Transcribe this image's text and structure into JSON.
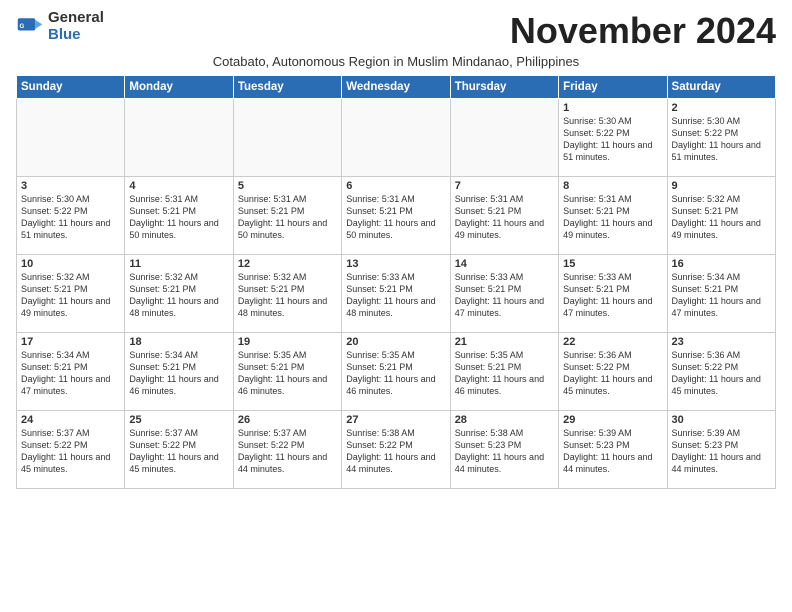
{
  "logo": {
    "general": "General",
    "blue": "Blue"
  },
  "title": "November 2024",
  "subtitle": "Cotabato, Autonomous Region in Muslim Mindanao, Philippines",
  "days_of_week": [
    "Sunday",
    "Monday",
    "Tuesday",
    "Wednesday",
    "Thursday",
    "Friday",
    "Saturday"
  ],
  "weeks": [
    [
      {
        "day": "",
        "info": ""
      },
      {
        "day": "",
        "info": ""
      },
      {
        "day": "",
        "info": ""
      },
      {
        "day": "",
        "info": ""
      },
      {
        "day": "",
        "info": ""
      },
      {
        "day": "1",
        "info": "Sunrise: 5:30 AM\nSunset: 5:22 PM\nDaylight: 11 hours and 51 minutes."
      },
      {
        "day": "2",
        "info": "Sunrise: 5:30 AM\nSunset: 5:22 PM\nDaylight: 11 hours and 51 minutes."
      }
    ],
    [
      {
        "day": "3",
        "info": "Sunrise: 5:30 AM\nSunset: 5:22 PM\nDaylight: 11 hours and 51 minutes."
      },
      {
        "day": "4",
        "info": "Sunrise: 5:31 AM\nSunset: 5:21 PM\nDaylight: 11 hours and 50 minutes."
      },
      {
        "day": "5",
        "info": "Sunrise: 5:31 AM\nSunset: 5:21 PM\nDaylight: 11 hours and 50 minutes."
      },
      {
        "day": "6",
        "info": "Sunrise: 5:31 AM\nSunset: 5:21 PM\nDaylight: 11 hours and 50 minutes."
      },
      {
        "day": "7",
        "info": "Sunrise: 5:31 AM\nSunset: 5:21 PM\nDaylight: 11 hours and 49 minutes."
      },
      {
        "day": "8",
        "info": "Sunrise: 5:31 AM\nSunset: 5:21 PM\nDaylight: 11 hours and 49 minutes."
      },
      {
        "day": "9",
        "info": "Sunrise: 5:32 AM\nSunset: 5:21 PM\nDaylight: 11 hours and 49 minutes."
      }
    ],
    [
      {
        "day": "10",
        "info": "Sunrise: 5:32 AM\nSunset: 5:21 PM\nDaylight: 11 hours and 49 minutes."
      },
      {
        "day": "11",
        "info": "Sunrise: 5:32 AM\nSunset: 5:21 PM\nDaylight: 11 hours and 48 minutes."
      },
      {
        "day": "12",
        "info": "Sunrise: 5:32 AM\nSunset: 5:21 PM\nDaylight: 11 hours and 48 minutes."
      },
      {
        "day": "13",
        "info": "Sunrise: 5:33 AM\nSunset: 5:21 PM\nDaylight: 11 hours and 48 minutes."
      },
      {
        "day": "14",
        "info": "Sunrise: 5:33 AM\nSunset: 5:21 PM\nDaylight: 11 hours and 47 minutes."
      },
      {
        "day": "15",
        "info": "Sunrise: 5:33 AM\nSunset: 5:21 PM\nDaylight: 11 hours and 47 minutes."
      },
      {
        "day": "16",
        "info": "Sunrise: 5:34 AM\nSunset: 5:21 PM\nDaylight: 11 hours and 47 minutes."
      }
    ],
    [
      {
        "day": "17",
        "info": "Sunrise: 5:34 AM\nSunset: 5:21 PM\nDaylight: 11 hours and 47 minutes."
      },
      {
        "day": "18",
        "info": "Sunrise: 5:34 AM\nSunset: 5:21 PM\nDaylight: 11 hours and 46 minutes."
      },
      {
        "day": "19",
        "info": "Sunrise: 5:35 AM\nSunset: 5:21 PM\nDaylight: 11 hours and 46 minutes."
      },
      {
        "day": "20",
        "info": "Sunrise: 5:35 AM\nSunset: 5:21 PM\nDaylight: 11 hours and 46 minutes."
      },
      {
        "day": "21",
        "info": "Sunrise: 5:35 AM\nSunset: 5:21 PM\nDaylight: 11 hours and 46 minutes."
      },
      {
        "day": "22",
        "info": "Sunrise: 5:36 AM\nSunset: 5:22 PM\nDaylight: 11 hours and 45 minutes."
      },
      {
        "day": "23",
        "info": "Sunrise: 5:36 AM\nSunset: 5:22 PM\nDaylight: 11 hours and 45 minutes."
      }
    ],
    [
      {
        "day": "24",
        "info": "Sunrise: 5:37 AM\nSunset: 5:22 PM\nDaylight: 11 hours and 45 minutes."
      },
      {
        "day": "25",
        "info": "Sunrise: 5:37 AM\nSunset: 5:22 PM\nDaylight: 11 hours and 45 minutes."
      },
      {
        "day": "26",
        "info": "Sunrise: 5:37 AM\nSunset: 5:22 PM\nDaylight: 11 hours and 44 minutes."
      },
      {
        "day": "27",
        "info": "Sunrise: 5:38 AM\nSunset: 5:22 PM\nDaylight: 11 hours and 44 minutes."
      },
      {
        "day": "28",
        "info": "Sunrise: 5:38 AM\nSunset: 5:23 PM\nDaylight: 11 hours and 44 minutes."
      },
      {
        "day": "29",
        "info": "Sunrise: 5:39 AM\nSunset: 5:23 PM\nDaylight: 11 hours and 44 minutes."
      },
      {
        "day": "30",
        "info": "Sunrise: 5:39 AM\nSunset: 5:23 PM\nDaylight: 11 hours and 44 minutes."
      }
    ]
  ]
}
